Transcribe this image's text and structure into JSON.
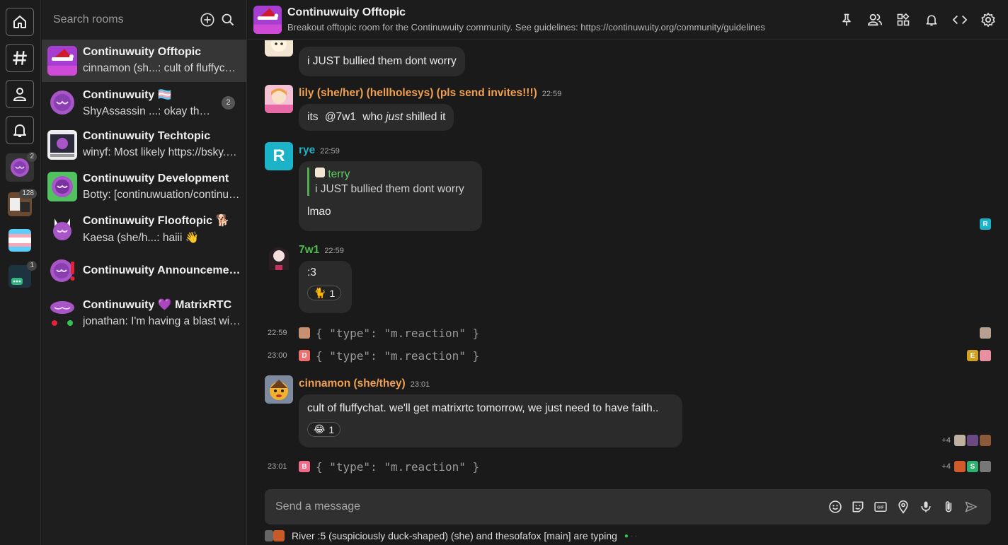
{
  "search": {
    "placeholder": "Search rooms"
  },
  "rail": {
    "badges": {
      "dev_space": "2",
      "pics_space": "128",
      "bot_space": "1"
    }
  },
  "rooms": [
    {
      "name": "Continuwuity Offtopic",
      "preview": "cinnamon (sh...: cult of fluffychat. we'll get matrixrtc tomorrow, we just need to have faith..",
      "count": ""
    },
    {
      "name": "Continuwuity 🏳️‍⚧️",
      "preview": "ShyAssassin ...: okay the ...",
      "count": "2"
    },
    {
      "name": "Continuwuity Techtopic",
      "preview": "winyf: Most likely https://bsky.app",
      "count": ""
    },
    {
      "name": "Continuwuity Development",
      "preview": "Botty: [continuwuation/continuwuity] ...",
      "count": ""
    },
    {
      "name": "Continuwuity Flooftopic 🐕",
      "preview": "Kaesa (she/h...: haiii 👋",
      "count": ""
    },
    {
      "name": "Continuwuity Announcements",
      "preview": "",
      "count": ""
    },
    {
      "name": "Continuwuity 💜 MatrixRTC",
      "preview": "jonathan: I'm having a blast with it",
      "count": ""
    }
  ],
  "header": {
    "title": "Continuwuity Offtopic",
    "topic": "Breakout offtopic room for the Continuwuity community. See guidelines: https://continuwuity.org/community/guidelines"
  },
  "messages": {
    "m1": {
      "text": "i JUST bullied them dont worry"
    },
    "m2": {
      "sender": "lily (she/her) (hellholesys) (pls send invites!!!)",
      "time": "22:59",
      "pre": "its ",
      "mention": "@7w1",
      "mid": " who ",
      "em": "just",
      "post": " shilled it"
    },
    "m3": {
      "sender": "rye",
      "time": "22:59",
      "reply_sender": "terry",
      "reply_text": "i JUST bullied them dont worry",
      "text": "lmao",
      "avatar_letter": "R"
    },
    "m4": {
      "sender": "7w1",
      "time": "22:59",
      "text": ":3",
      "reaction_emoji": "🐈",
      "reaction_count": "1"
    },
    "e1": {
      "time": "22:59",
      "text": "{ \"type\": \"m.reaction\" }"
    },
    "e2": {
      "time": "23:00",
      "text": "{ \"type\": \"m.reaction\" }",
      "letter": "D"
    },
    "m5": {
      "sender": "cinnamon (she/they)",
      "time": "23:01",
      "text": "cult of fluffychat. we'll get matrixrtc tomorrow, we just need to have faith..",
      "reaction_emoji": "😂",
      "reaction_count": "1",
      "receipts_extra": "+4"
    },
    "e3": {
      "time": "23:01",
      "text": "{ \"type\": \"m.reaction\" }",
      "letter": "B",
      "receipts_extra": "+4"
    }
  },
  "receipt_letters": {
    "e2": "E",
    "e3": "S",
    "m3": "R"
  },
  "composer": {
    "placeholder": "Send a message"
  },
  "typing": {
    "text": "River :5 (suspiciously duck-shaped) (she) and thesofafox [main] are typing"
  },
  "colors": {
    "lily": "#f0a050",
    "rye": "#1ab3c8",
    "sevenw1": "#4cbb4c",
    "cinnamon": "#f0a050"
  }
}
